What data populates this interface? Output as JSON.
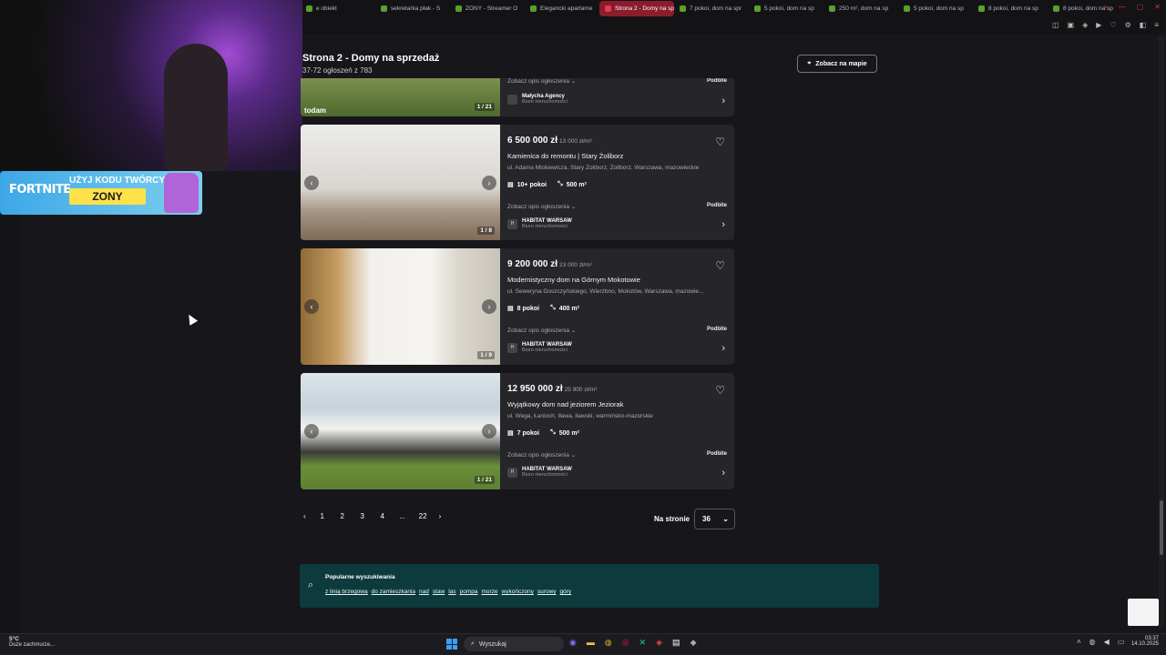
{
  "browser": {
    "tabs": [
      {
        "label": "e obiekt"
      },
      {
        "label": "sekretarka płak - S"
      },
      {
        "label": "ZONY - Streamer O"
      },
      {
        "label": "Elegancki apartame"
      },
      {
        "label": "Strona 2 - Domy na sprz",
        "active": true
      },
      {
        "label": "7 pokoi, dom na spr"
      },
      {
        "label": "5 pokoi, dom na sp"
      },
      {
        "label": "250 m², dom na sp"
      },
      {
        "label": "5 pokoi, dom na sp"
      },
      {
        "label": "8 pokoi, dom na sp"
      },
      {
        "label": "8 pokoi, dom na sp"
      }
    ]
  },
  "stream": {
    "banner_brand": "FORTNITE",
    "banner_line": "UŻYJ KODU TWÓRCY",
    "banner_code": "ZONY"
  },
  "page": {
    "title": "Strona 2 - Domy na sprzedaż",
    "subtitle": "37-72 ogłoszeń z 783",
    "map_button": "Zobacz na mapie"
  },
  "listings": [
    {
      "price": "",
      "price_m2": "",
      "title": "",
      "address": "",
      "rooms": "",
      "area": "",
      "desc_toggle": "Zobacz opis ogłoszenia",
      "promo": "Podbite",
      "agency": "Małycha Agency",
      "agency_type": "Biuro nieruchomości",
      "photo_count": "1 / 21",
      "img_caption": "todam"
    },
    {
      "price": "6 500 000 zł",
      "price_m2": "13 000 zł/m²",
      "title": "Kamienica do remontu | Stary Żoliborz",
      "address": "ul. Adama Mickiewicza, Stary Żoliborz, Żoliborz, Warszawa, mazowieckie",
      "rooms": "10+ pokoi",
      "area": "500 m²",
      "desc_toggle": "Zobacz opis ogłoszenia",
      "promo": "Podbite",
      "agency": "HABITAT WARSAW",
      "agency_type": "Biuro nieruchomości",
      "photo_count": "1 / 8"
    },
    {
      "price": "9 200 000 zł",
      "price_m2": "23 000 zł/m²",
      "title": "Modernistyczny dom na Górnym Mokotowie",
      "address": "ul. Seweryna Goszczyńskiego, Wierzbno, Mokotów, Warszawa, mazowie...",
      "rooms": "8 pokoi",
      "area": "400 m²",
      "desc_toggle": "Zobacz opis ogłoszenia",
      "promo": "Podbite",
      "agency": "HABITAT WARSAW",
      "agency_type": "Biuro nieruchomości",
      "photo_count": "1 / 9"
    },
    {
      "price": "12 950 000 zł",
      "price_m2": "25 900 zł/m²",
      "title": "Wyjątkowy dom nad jeziorem Jeziorak",
      "address": "ul. Wega, Łanioch, Iława, iławski, warmińsko-mazurskie",
      "rooms": "7 pokoi",
      "area": "500 m²",
      "desc_toggle": "Zobacz opis ogłoszenia",
      "promo": "Podbite",
      "agency": "HABITAT WARSAW",
      "agency_type": "Biuro nieruchomości",
      "photo_count": "1 / 21"
    }
  ],
  "pagination": {
    "pages": [
      "1",
      "2",
      "3",
      "4",
      "...",
      "22"
    ],
    "per_page_label": "Na stronie",
    "per_page_value": "36"
  },
  "popular": {
    "title": "Popularne wyszukiwania",
    "links": [
      "z linią brzegową",
      "do zamieszkania",
      "nad",
      "staw",
      "las",
      "pompa",
      "morze",
      "wykończony",
      "surowy",
      "góry"
    ]
  },
  "taskbar": {
    "temp": "5°C",
    "weather": "Duże zachmurze...",
    "search": "Wyszukaj",
    "time": "03:37",
    "date": "14.10.2025"
  },
  "colors": {
    "active_tab": "#8a1c2c",
    "popular_bg": "#0d3b3d",
    "card_bg": "#25252a"
  }
}
